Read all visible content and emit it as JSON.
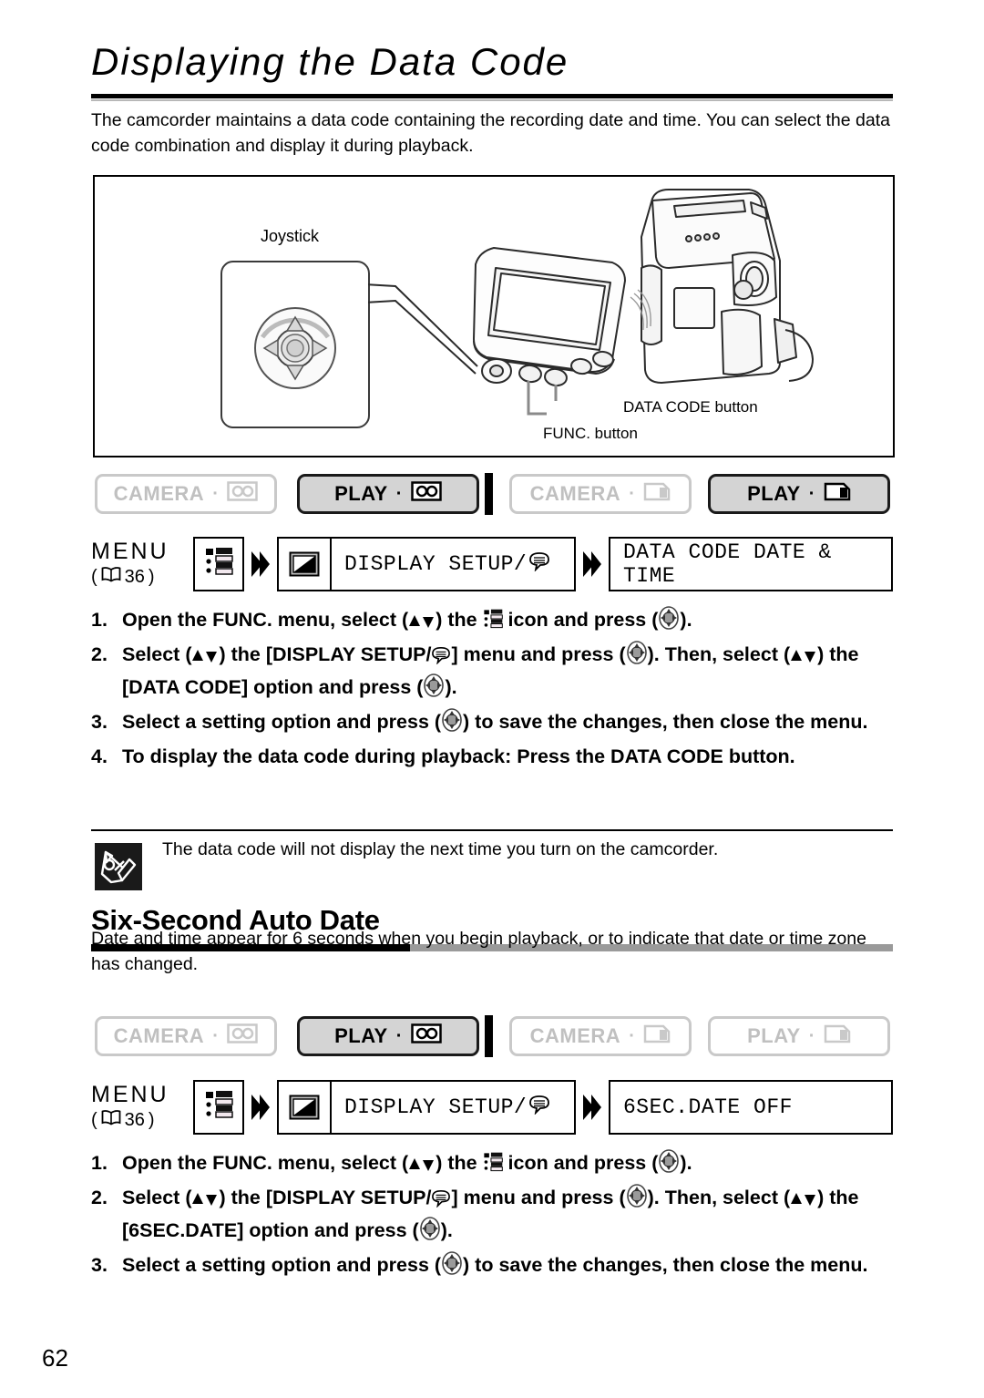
{
  "page": {
    "title": "Displaying the Data Code",
    "number": "62",
    "intro": "The camcorder maintains a data code containing the recording date and time. You can select the data code combination and display it during playback."
  },
  "illustration": {
    "joystick_label": "Joystick",
    "callout_datacode": "DATA CODE button",
    "callout_func": "FUNC. button"
  },
  "section1": {
    "modes": [
      {
        "label": "CAMERA",
        "media_icon": "tape-icon",
        "state": "off"
      },
      {
        "label": "PLAY",
        "media_icon": "tape-icon",
        "state": "on"
      },
      {
        "label": "CAMERA",
        "media_icon": "card-icon",
        "state": "off"
      },
      {
        "label": "PLAY",
        "media_icon": "card-icon",
        "state": "on"
      }
    ],
    "menu_flow": {
      "menu_word": "MENU",
      "page_ref": "36",
      "book_icon": "book-icon",
      "step1_icon": "menu-list-icon",
      "step2_icon": "display-setup-icon",
      "step2_label": "DISPLAY SETUP/",
      "step2_suffix_icon": "speech-bubble-icon",
      "step3_label": "DATA CODE DATE & TIME"
    },
    "steps": [
      {
        "num": "1.",
        "parts": [
          "Open the FUNC. menu, select (",
          "updown",
          ") the ",
          "menu-list",
          " icon and press (",
          "joystick",
          ")."
        ]
      },
      {
        "num": "2.",
        "parts": [
          "Select (",
          "updown",
          ") the [DISPLAY SETUP/",
          "speech",
          "] menu and press (",
          "joystick",
          "). Then, select (",
          "updown",
          ") the [DATA CODE] option and press (",
          "joystick",
          ")."
        ]
      },
      {
        "num": "3.",
        "parts": [
          "Select a setting option and press (",
          "joystick",
          ") to save the changes, then close the menu."
        ]
      },
      {
        "num": "4.",
        "parts": [
          "To display the data code during playback: Press the DATA CODE button."
        ]
      }
    ],
    "note": "The data code will not display the next time you turn on the camcorder.",
    "note_icon": "pencil-note-icon"
  },
  "section2": {
    "heading": "Six-Second Auto Date",
    "paragraph": "Date and time appear for 6 seconds when you begin playback, or to indicate that date or time zone has changed.",
    "modes": [
      {
        "label": "CAMERA",
        "media_icon": "tape-icon",
        "state": "off"
      },
      {
        "label": "PLAY",
        "media_icon": "tape-icon",
        "state": "on"
      },
      {
        "label": "CAMERA",
        "media_icon": "card-icon",
        "state": "off"
      },
      {
        "label": "PLAY",
        "media_icon": "card-icon",
        "state": "off"
      }
    ],
    "menu_flow": {
      "menu_word": "MENU",
      "page_ref": "36",
      "book_icon": "book-icon",
      "step1_icon": "menu-list-icon",
      "step2_icon": "display-setup-icon",
      "step2_label": "DISPLAY SETUP/",
      "step2_suffix_icon": "speech-bubble-icon",
      "step3_label": "6SEC.DATE OFF"
    },
    "steps": [
      {
        "num": "1.",
        "parts": [
          "Open the FUNC. menu, select (",
          "updown",
          ") the ",
          "menu-list",
          " icon and press (",
          "joystick",
          ")."
        ]
      },
      {
        "num": "2.",
        "parts": [
          "Select (",
          "updown",
          ") the [DISPLAY SETUP/",
          "speech",
          "] menu and press (",
          "joystick",
          "). Then, select (",
          "updown",
          ") the [6SEC.DATE] option and press (",
          "joystick",
          ")."
        ]
      },
      {
        "num": "3.",
        "parts": [
          "Select a setting option and press (",
          "joystick",
          ") to save the changes, then close the menu."
        ]
      }
    ]
  },
  "colors": {
    "rule_black": "#000000",
    "rule_gray": "#9a9a9a",
    "badge_off_border": "#c9c9c9",
    "badge_off_text": "#c0c0c0",
    "badge_on_bg": "#d4d4d4"
  }
}
